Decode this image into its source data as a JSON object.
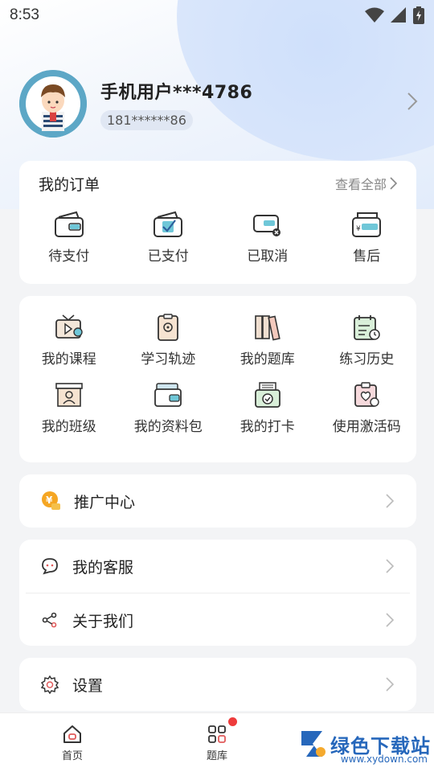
{
  "status_bar": {
    "time": "8:53"
  },
  "profile": {
    "name": "手机用户***4786",
    "phone": "181******86"
  },
  "orders": {
    "title": "我的订单",
    "view_all": "查看全部",
    "items": [
      {
        "label": "待支付",
        "icon": "wallet-icon"
      },
      {
        "label": "已支付",
        "icon": "wallet-check-icon"
      },
      {
        "label": "已取消",
        "icon": "wallet-cancel-icon"
      },
      {
        "label": "售后",
        "icon": "wallet-yen-icon"
      }
    ]
  },
  "tools": {
    "row1": [
      {
        "label": "我的课程",
        "icon": "video-course-icon"
      },
      {
        "label": "学习轨迹",
        "icon": "clipboard-track-icon"
      },
      {
        "label": "我的题库",
        "icon": "books-icon"
      },
      {
        "label": "练习历史",
        "icon": "calendar-history-icon"
      }
    ],
    "row2": [
      {
        "label": "我的班级",
        "icon": "class-board-icon"
      },
      {
        "label": "我的资料包",
        "icon": "folder-package-icon"
      },
      {
        "label": "我的打卡",
        "icon": "check-in-icon"
      },
      {
        "label": "使用激活码",
        "icon": "activation-code-icon"
      }
    ]
  },
  "menu": {
    "promo": "推广中心",
    "service": "我的客服",
    "about": "关于我们",
    "settings": "设置"
  },
  "tabbar": {
    "home": "首页",
    "questions": "题库"
  },
  "watermark": {
    "text": "绿色下载站",
    "url": "www.xydown.com"
  },
  "colors": {
    "accent_red": "#ee3b3b",
    "icon_orange": "#f5a623",
    "avatar_bg": "#5da7c6"
  }
}
